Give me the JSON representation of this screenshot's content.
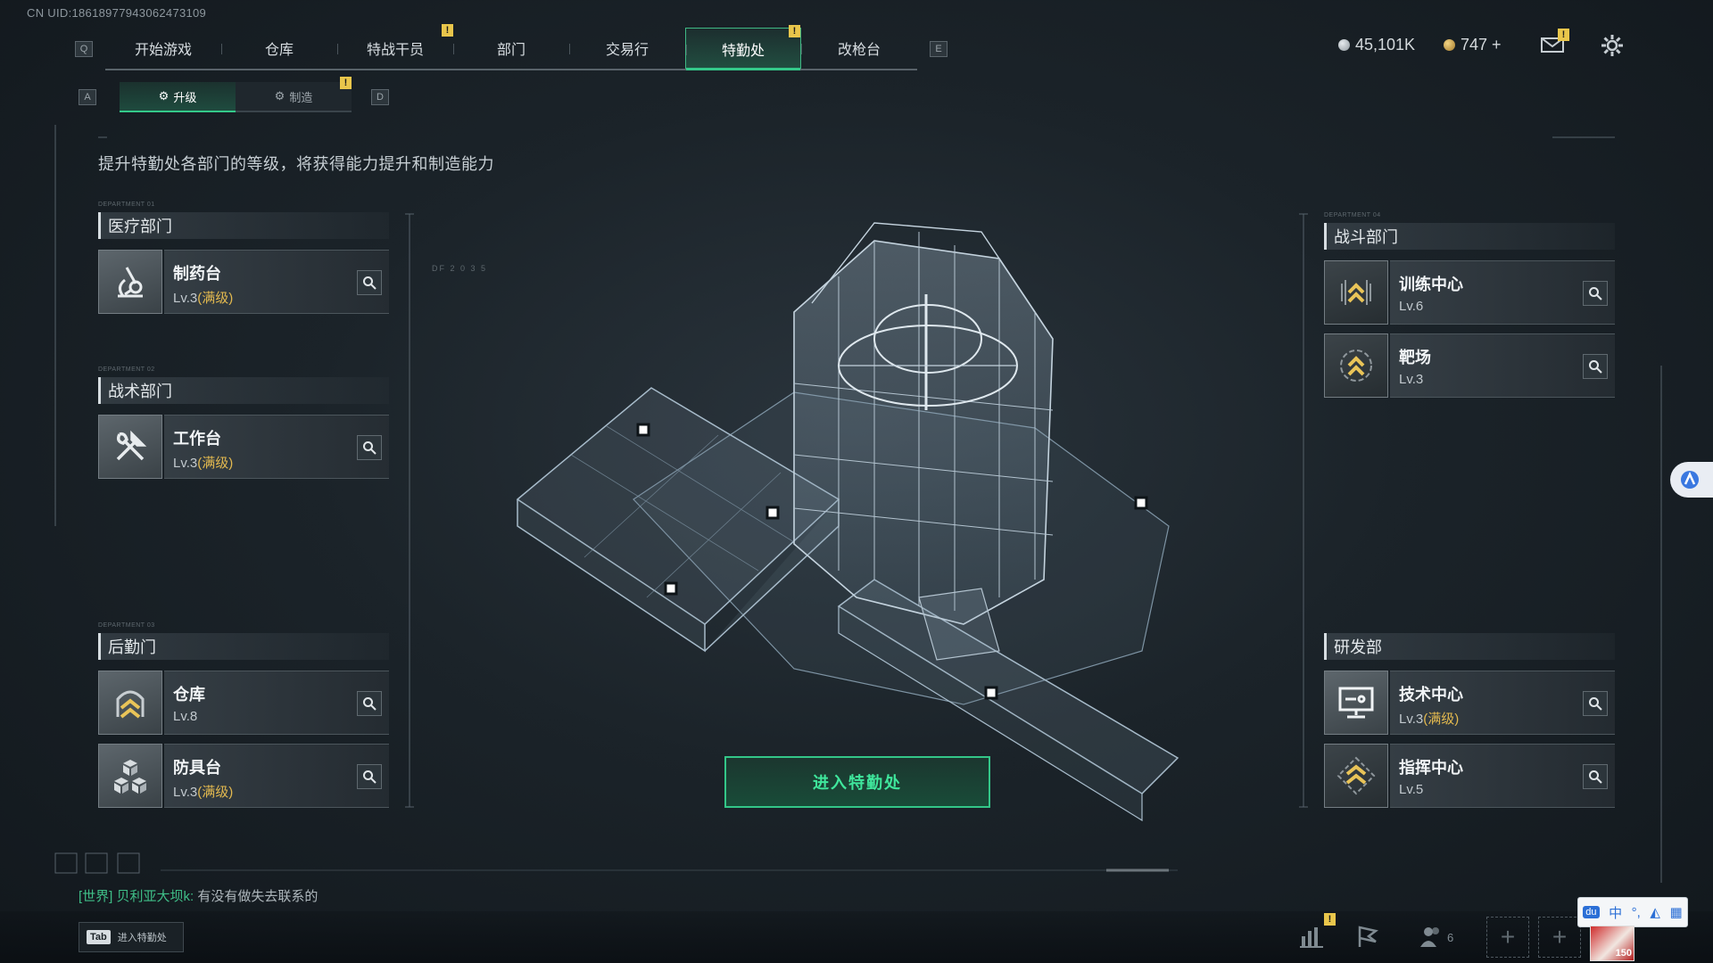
{
  "uid": "CN UID:18618977943062473109",
  "nav": {
    "left_key": "Q",
    "right_key": "E",
    "items": [
      {
        "label": "开始游戏"
      },
      {
        "label": "仓库"
      },
      {
        "label": "特战干员"
      },
      {
        "label": "部门"
      },
      {
        "label": "交易行"
      },
      {
        "label": "特勤处"
      },
      {
        "label": "改枪台"
      }
    ],
    "active_index": 5,
    "warn_mark": "!"
  },
  "currency": {
    "silver": "45,101K",
    "gold": "747 +"
  },
  "subtabs": {
    "left_key": "A",
    "right_key": "D",
    "items": [
      {
        "label": "升级"
      },
      {
        "label": "制造"
      }
    ],
    "active_index": 0
  },
  "description": "提升特勤处各部门的等级，将获得能力提升和制造能力",
  "departments": {
    "medical": {
      "code": "DEPARTMENT 01",
      "title": "医疗部门",
      "cards": [
        {
          "name": "制药台",
          "level": "Lv.3",
          "max": "(满级)",
          "icon": "microscope-icon"
        }
      ]
    },
    "tactical": {
      "code": "DEPARTMENT 02",
      "title": "战术部门",
      "cards": [
        {
          "name": "工作台",
          "level": "Lv.3",
          "max": "(满级)",
          "icon": "tools-icon"
        }
      ]
    },
    "logistics": {
      "code": "DEPARTMENT 03",
      "title": "后勤门",
      "cards": [
        {
          "name": "仓库",
          "level": "Lv.8",
          "max": "",
          "icon": "rank-chevron-icon"
        },
        {
          "name": "防具台",
          "level": "Lv.3",
          "max": "(满级)",
          "icon": "cubes-icon"
        }
      ]
    },
    "combat": {
      "code": "DEPARTMENT 04",
      "title": "战斗部门",
      "cards": [
        {
          "name": "训练中心",
          "level": "Lv.6",
          "max": "",
          "icon": "rank-chevron-icon"
        },
        {
          "name": "靶场",
          "level": "Lv.3",
          "max": "",
          "icon": "rank-chevron-icon"
        }
      ]
    },
    "research": {
      "code": "",
      "title": "研发部",
      "cards": [
        {
          "name": "技术中心",
          "level": "Lv.3",
          "max": "(满级)",
          "icon": "monitor-icon"
        },
        {
          "name": "指挥中心",
          "level": "Lv.5",
          "max": "",
          "icon": "rank-chevron-icon"
        }
      ]
    }
  },
  "center": {
    "enter_button": "进入特勤处",
    "readout": "DF 2 0 3 5"
  },
  "chat": {
    "channel": "[世界]",
    "sender": "贝利亚大坝k:",
    "message": "有没有做失去联系的"
  },
  "bottom": {
    "tab_key": "Tab",
    "tab_label": "进入特勤处",
    "friends_count": "6"
  },
  "ime": {
    "lang": "中",
    "punct": "°,"
  },
  "avatar_text": "150"
}
